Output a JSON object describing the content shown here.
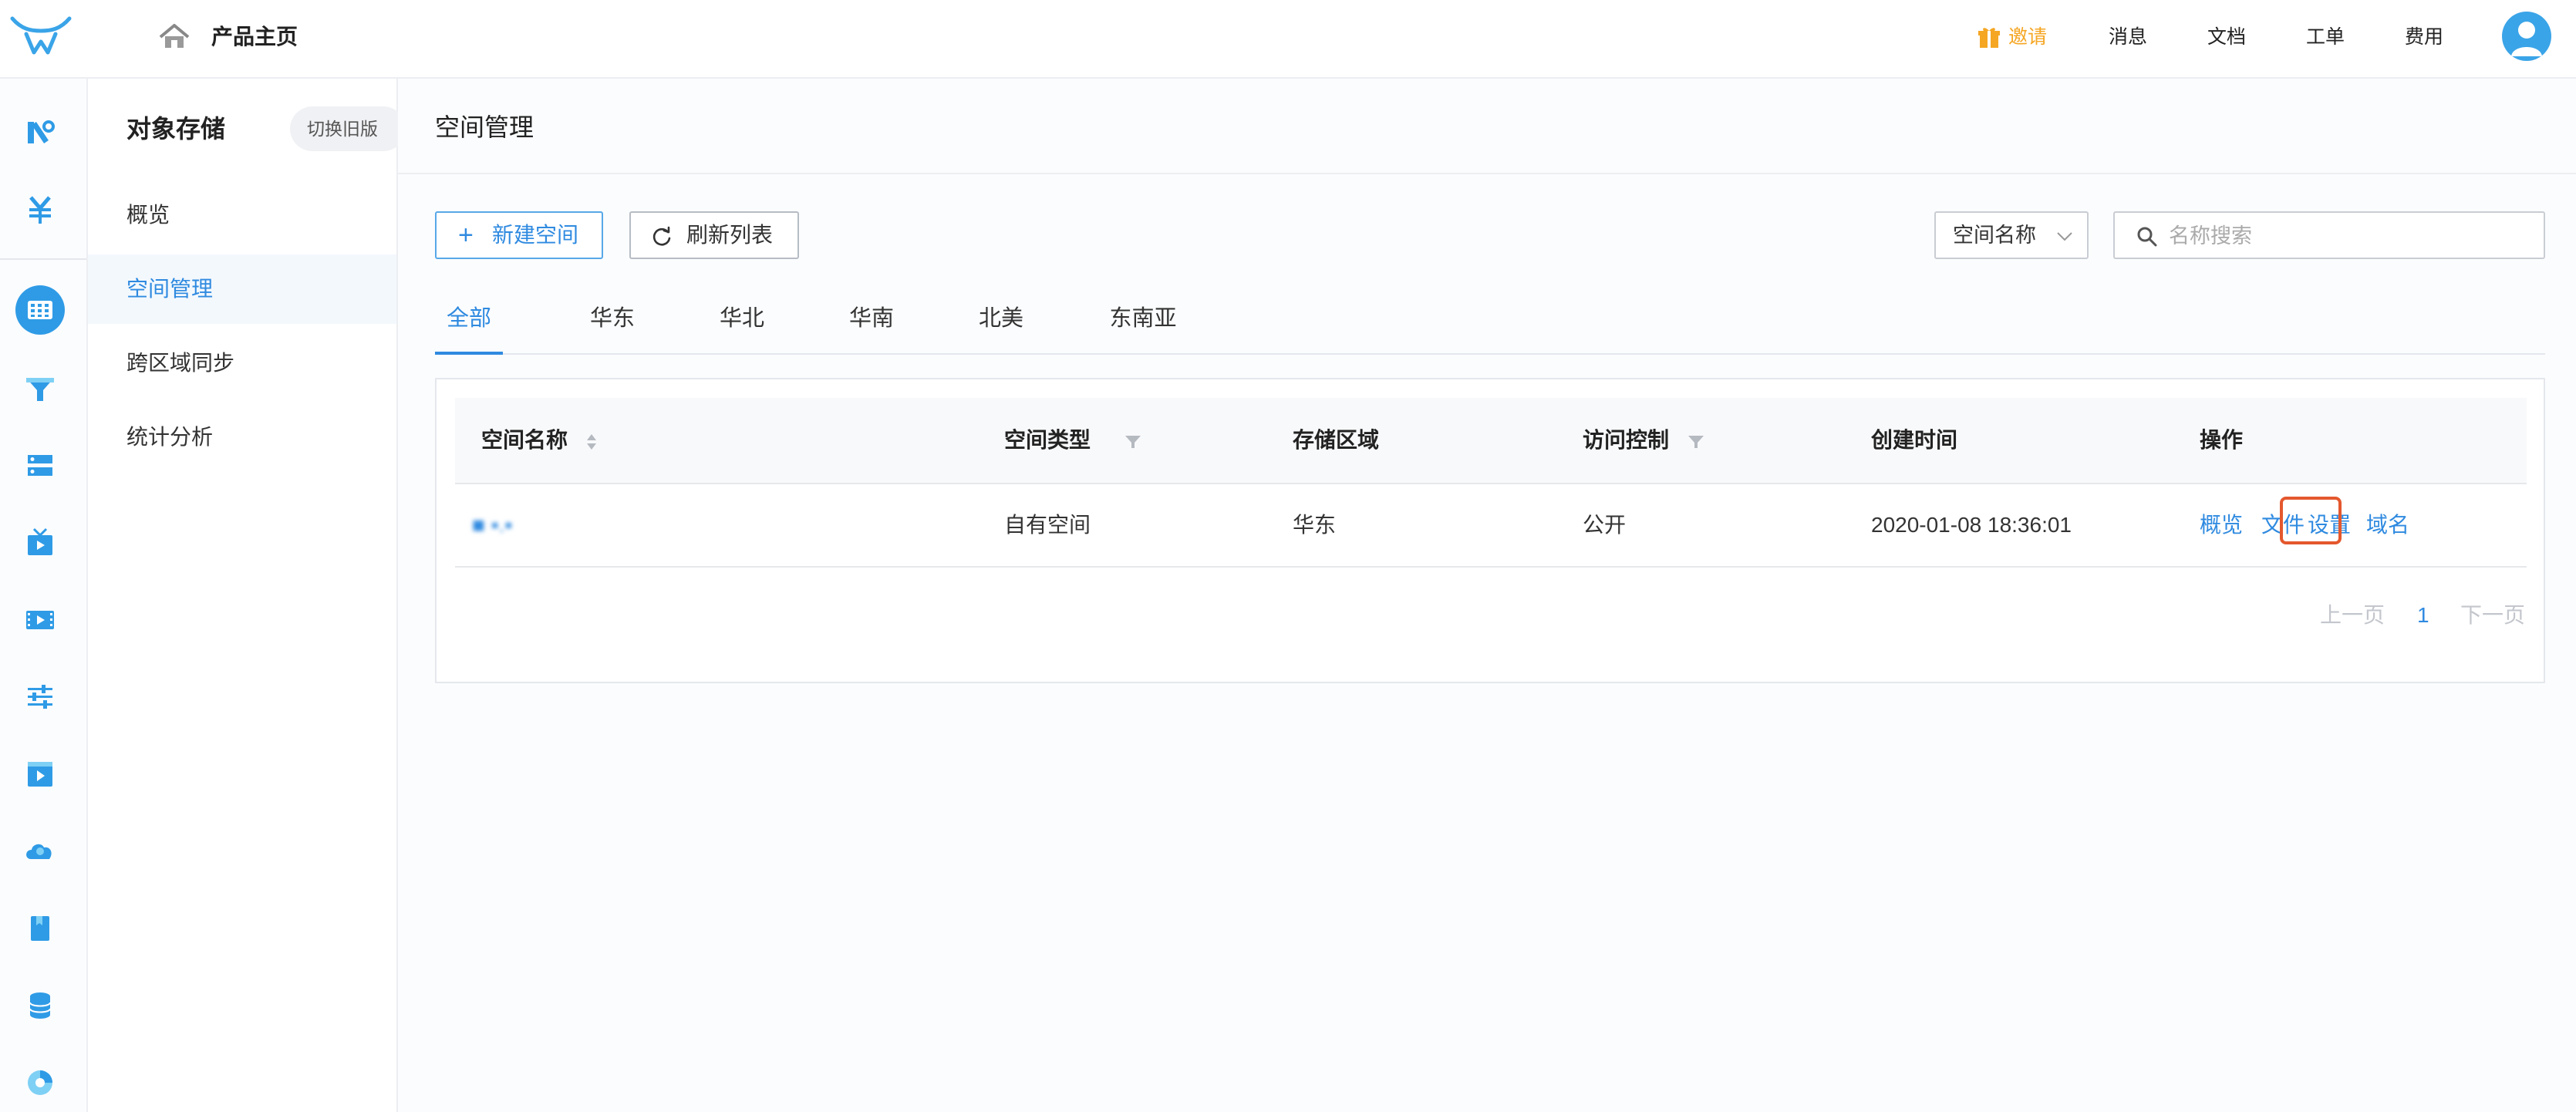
{
  "header": {
    "home_title": "产品主页",
    "nav": {
      "invite": "邀请",
      "messages": "消息",
      "docs": "文档",
      "tickets": "工单",
      "billing": "费用"
    },
    "colors": {
      "accent": "#2f8ae0",
      "invite": "#f5a623"
    }
  },
  "rail": {
    "icons": [
      "kodo-logo-icon",
      "yuan-currency-icon",
      "storage-grid-icon",
      "cdn-funnel-icon",
      "server-icon",
      "live-tv-icon",
      "video-icon",
      "sliders-icon",
      "media-play-icon",
      "cloud-icon",
      "bookmark-icon",
      "database-icon",
      "pie-icon"
    ]
  },
  "sidebar": {
    "title": "对象存储",
    "switch_old": "切换旧版",
    "items": [
      {
        "label": "概览",
        "active": false
      },
      {
        "label": "空间管理",
        "active": true
      },
      {
        "label": "跨区域同步",
        "active": false
      },
      {
        "label": "统计分析",
        "active": false
      }
    ]
  },
  "main": {
    "title": "空间管理",
    "toolbar": {
      "new_label": "新建空间",
      "refresh_label": "刷新列表",
      "filter_select": "空间名称",
      "search_placeholder": "名称搜索"
    },
    "tabs": [
      "全部",
      "华东",
      "华北",
      "华南",
      "北美",
      "东南亚"
    ],
    "table": {
      "columns": [
        "空间名称",
        "空间类型",
        "存储区域",
        "访问控制",
        "创建时间",
        "操作"
      ],
      "rows": [
        {
          "name": "■ ▪.▪",
          "type": "自有空间",
          "region": "华东",
          "access": "公开",
          "created": "2020-01-08 18:36:01",
          "ops": [
            "概览",
            "文件",
            "设置",
            "域名"
          ]
        }
      ]
    },
    "pagination": {
      "prev": "上一页",
      "current": "1",
      "next": "下一页"
    }
  }
}
